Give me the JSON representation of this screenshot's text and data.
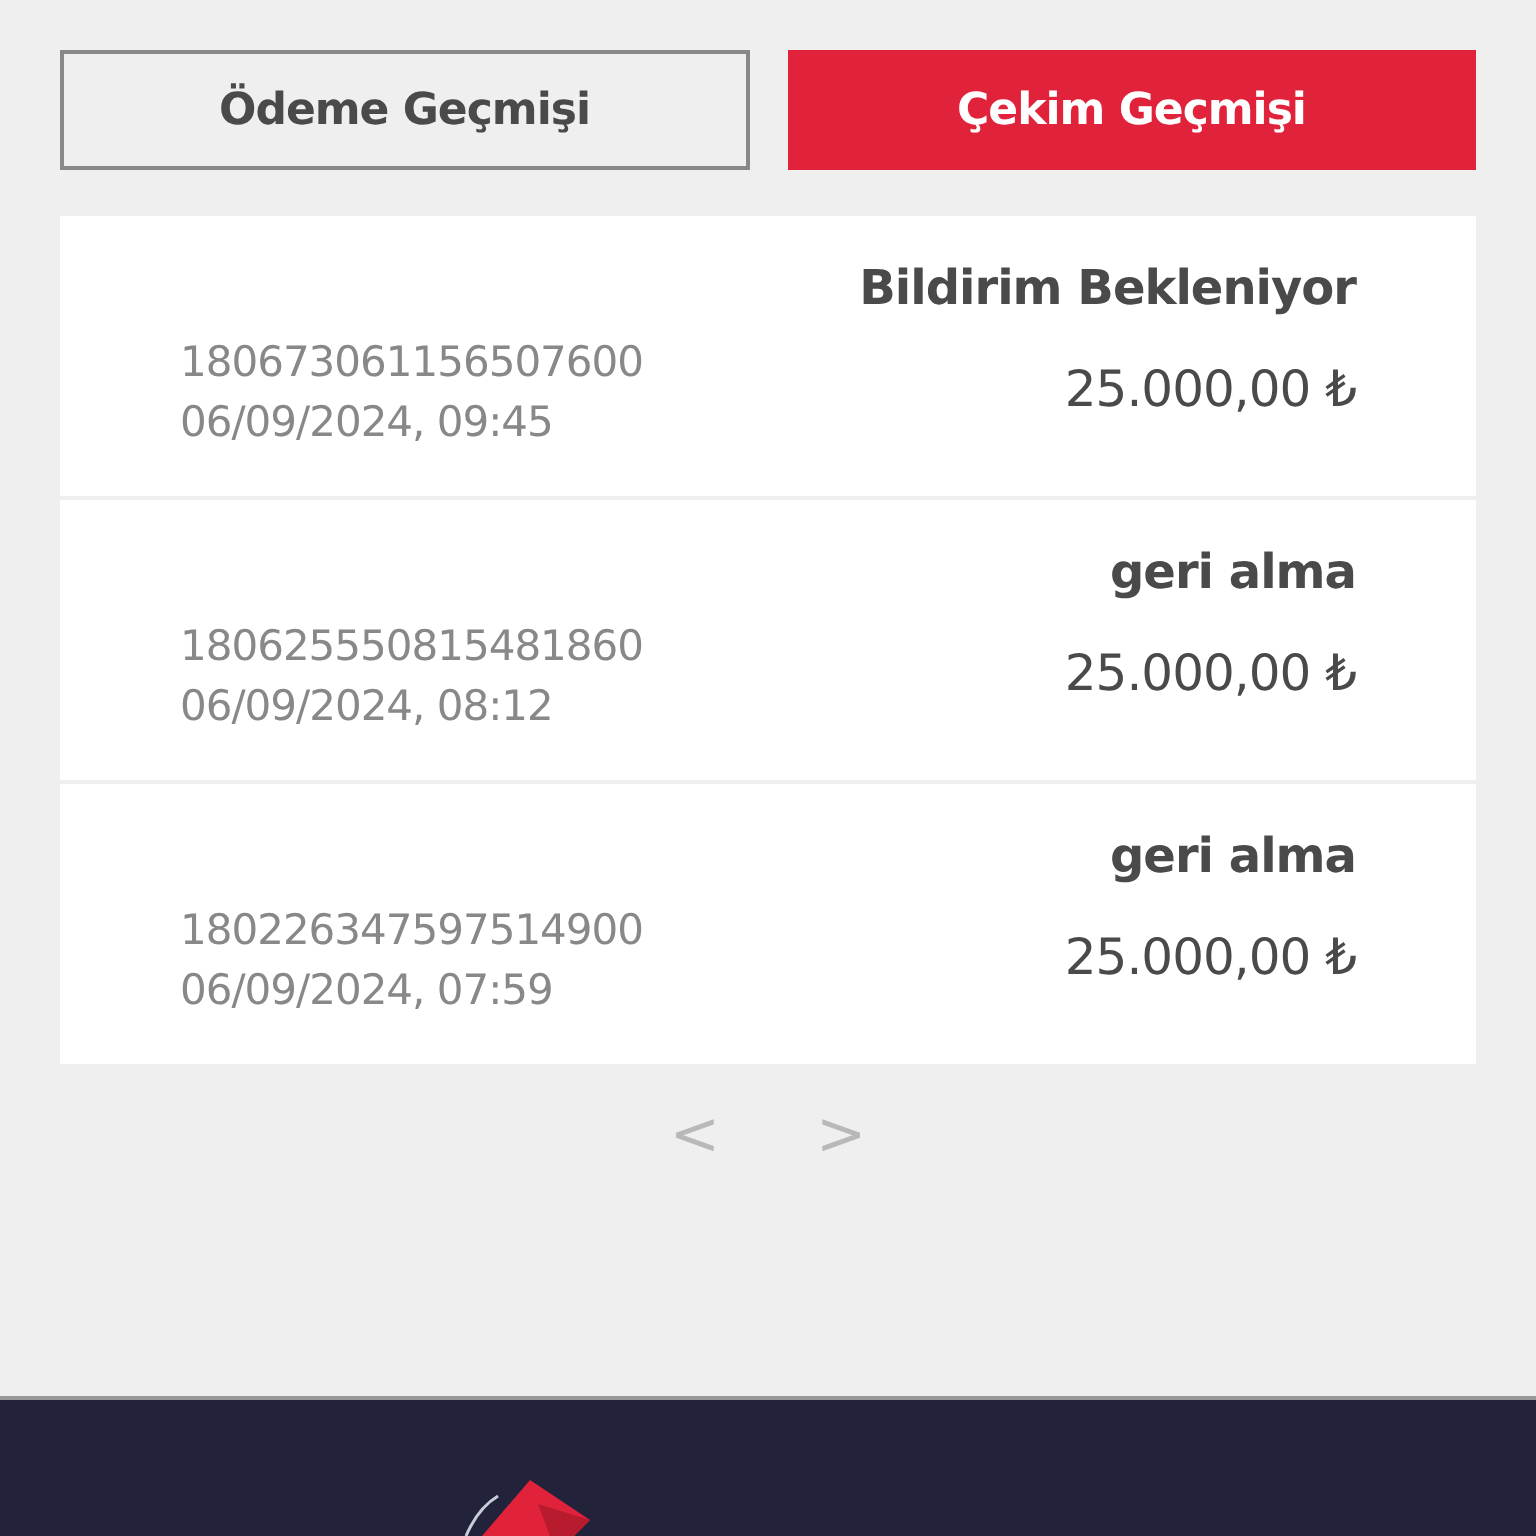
{
  "tabs": [
    {
      "label": "Ödeme Geçmişi",
      "selected": false
    },
    {
      "label": "Çekim Geçmişi",
      "selected": true
    }
  ],
  "transactions": [
    {
      "status": "Bildirim Bekleniyor",
      "id": "180673061156507600",
      "datetime": "06/09/2024, 09:45",
      "amount": "25.000,00 ₺"
    },
    {
      "status": "geri alma",
      "id": "180625550815481860",
      "datetime": "06/09/2024, 08:12",
      "amount": "25.000,00 ₺"
    },
    {
      "status": "geri alma",
      "id": "180226347597514900",
      "datetime": "06/09/2024, 07:59",
      "amount": "25.000,00 ₺"
    }
  ],
  "pagination": {
    "previous": "<",
    "next": ">"
  }
}
